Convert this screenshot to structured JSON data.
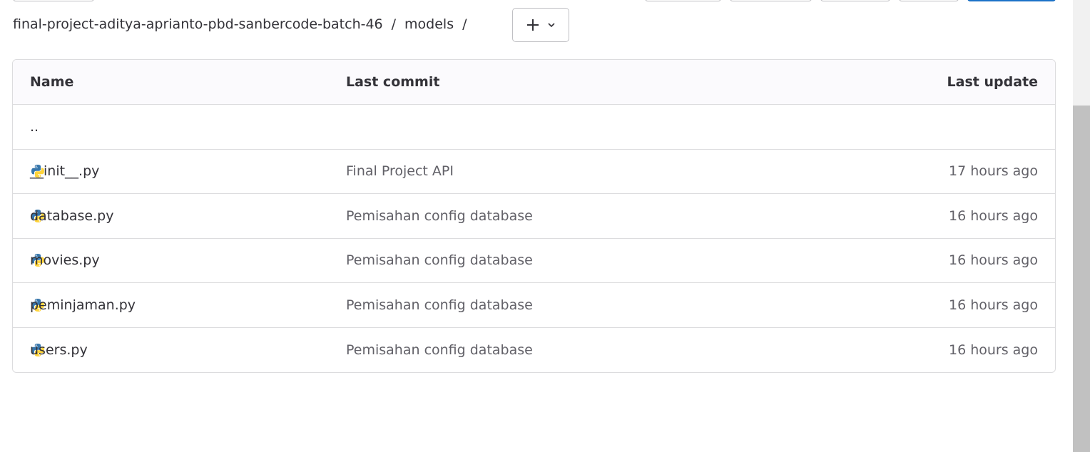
{
  "breadcrumb": {
    "project": "final-project-aditya-aprianto-pbd-sanbercode-batch-46",
    "separator": "/",
    "folder": "models",
    "trailing_separator": "/"
  },
  "add_dropdown": {
    "icon": "plus-icon",
    "caret": "chevron-down-icon"
  },
  "table": {
    "headers": {
      "name": "Name",
      "last_commit": "Last commit",
      "last_update": "Last update"
    },
    "parent_row": "..",
    "rows": [
      {
        "name": "__init__.py",
        "commit": "Final Project API",
        "updated": "17 hours ago",
        "icon": "python-icon"
      },
      {
        "name": "database.py",
        "commit": "Pemisahan config database",
        "updated": "16 hours ago",
        "icon": "python-icon"
      },
      {
        "name": "movies.py",
        "commit": "Pemisahan config database",
        "updated": "16 hours ago",
        "icon": "python-icon"
      },
      {
        "name": "peminjaman.py",
        "commit": "Pemisahan config database",
        "updated": "16 hours ago",
        "icon": "python-icon"
      },
      {
        "name": "users.py",
        "commit": "Pemisahan config database",
        "updated": "16 hours ago",
        "icon": "python-icon"
      }
    ]
  },
  "colors": {
    "python_blue": "#3776ab",
    "python_yellow": "#ffd43b",
    "primary_button": "#1f75cb"
  }
}
